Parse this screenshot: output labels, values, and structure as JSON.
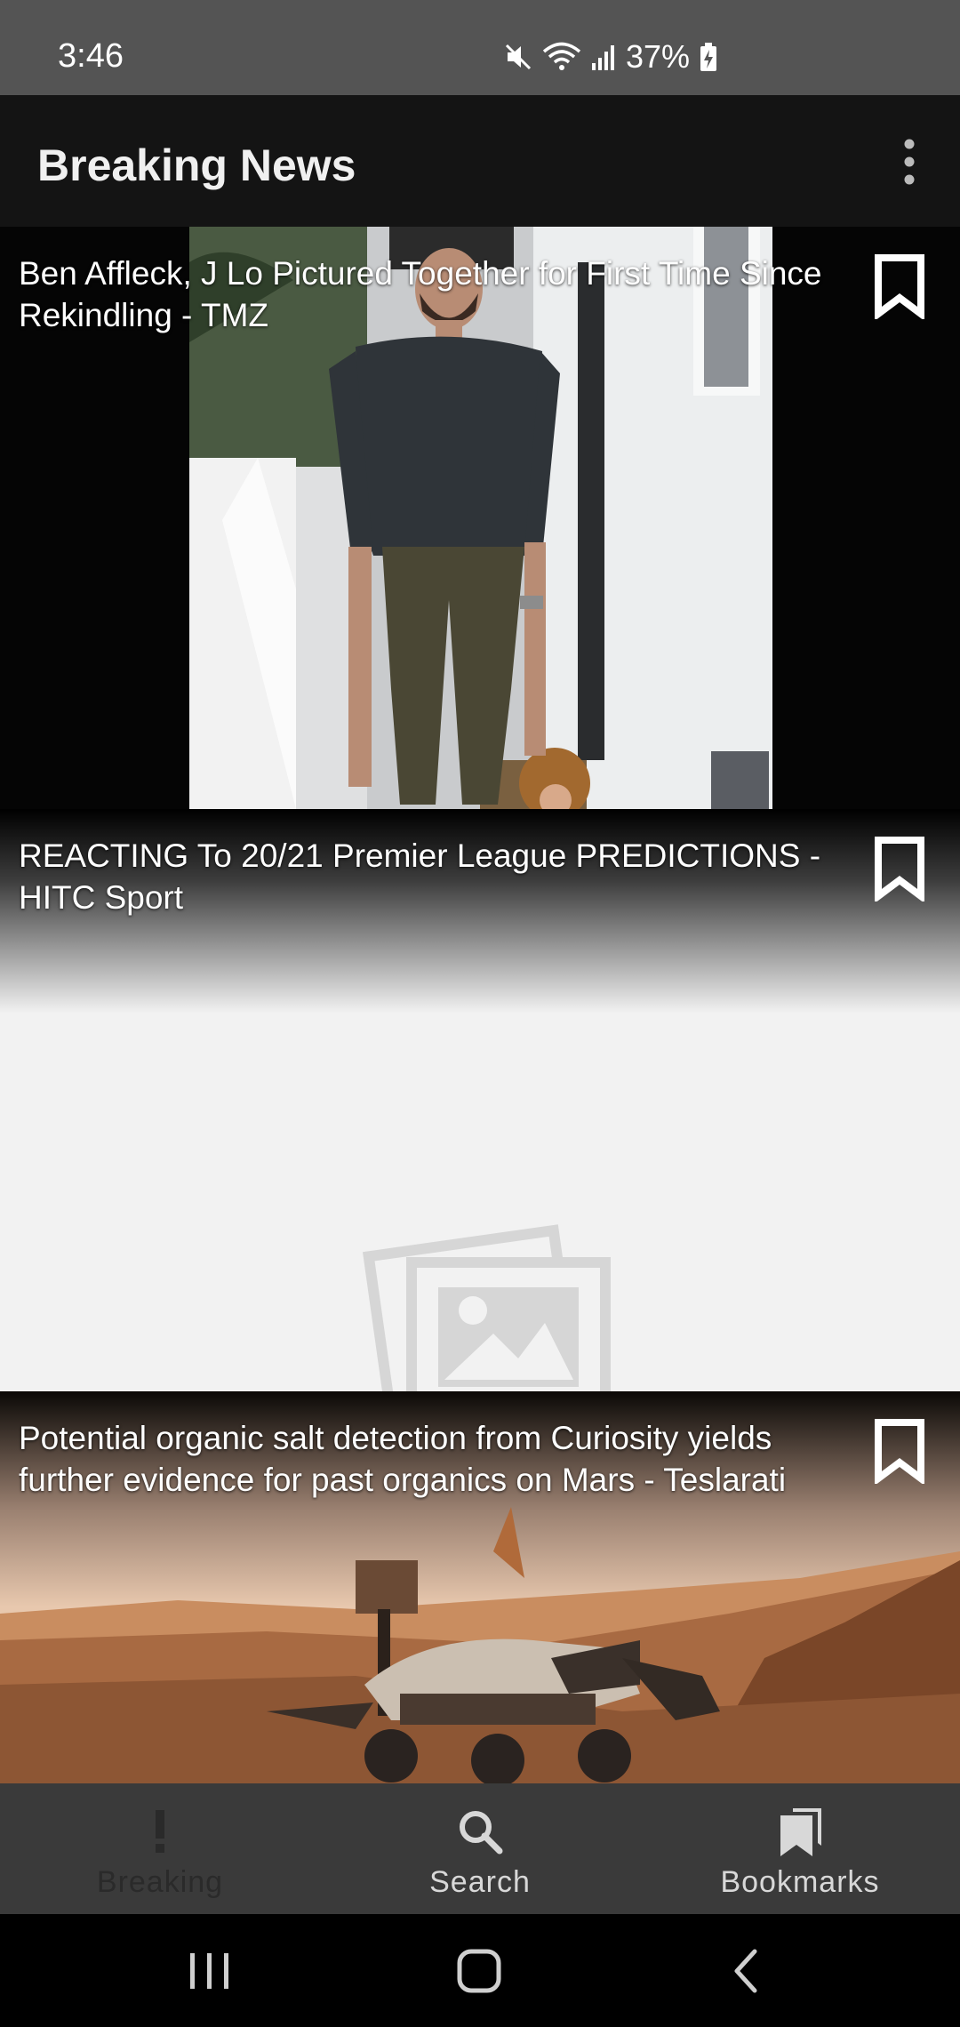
{
  "status_bar": {
    "time": "3:46",
    "battery": "37%",
    "icons": [
      "mute-icon",
      "wifi-icon",
      "signal-icon",
      "battery-charging-icon"
    ]
  },
  "app_bar": {
    "title": "Breaking News",
    "menu_icon": "more-vertical-icon"
  },
  "articles": [
    {
      "title": "Ben Affleck, J Lo Pictured Together for First Time Since Rekindling - TMZ",
      "bookmark_icon": "bookmark-outline-icon"
    },
    {
      "title": "REACTING To 20/21 Premier League PREDICTIONS - HITC Sport",
      "bookmark_icon": "bookmark-outline-icon"
    },
    {
      "title": "Potential organic salt detection from Curiosity yields further evidence for past organics on Mars - Teslarati",
      "bookmark_icon": "bookmark-outline-icon"
    }
  ],
  "bottom_nav": {
    "items": [
      {
        "label": "Breaking",
        "icon": "exclamation-icon",
        "selected": true
      },
      {
        "label": "Search",
        "icon": "search-icon",
        "selected": false
      },
      {
        "label": "Bookmarks",
        "icon": "bookmarks-icon",
        "selected": false
      }
    ]
  },
  "system_nav": [
    "recents-icon",
    "home-icon",
    "back-icon"
  ],
  "colors": {
    "status_bar": "#545454",
    "app_bar": "#141414",
    "bottom_nav": "#3a3a3a",
    "placeholder_bg": "#f2f2f2"
  }
}
